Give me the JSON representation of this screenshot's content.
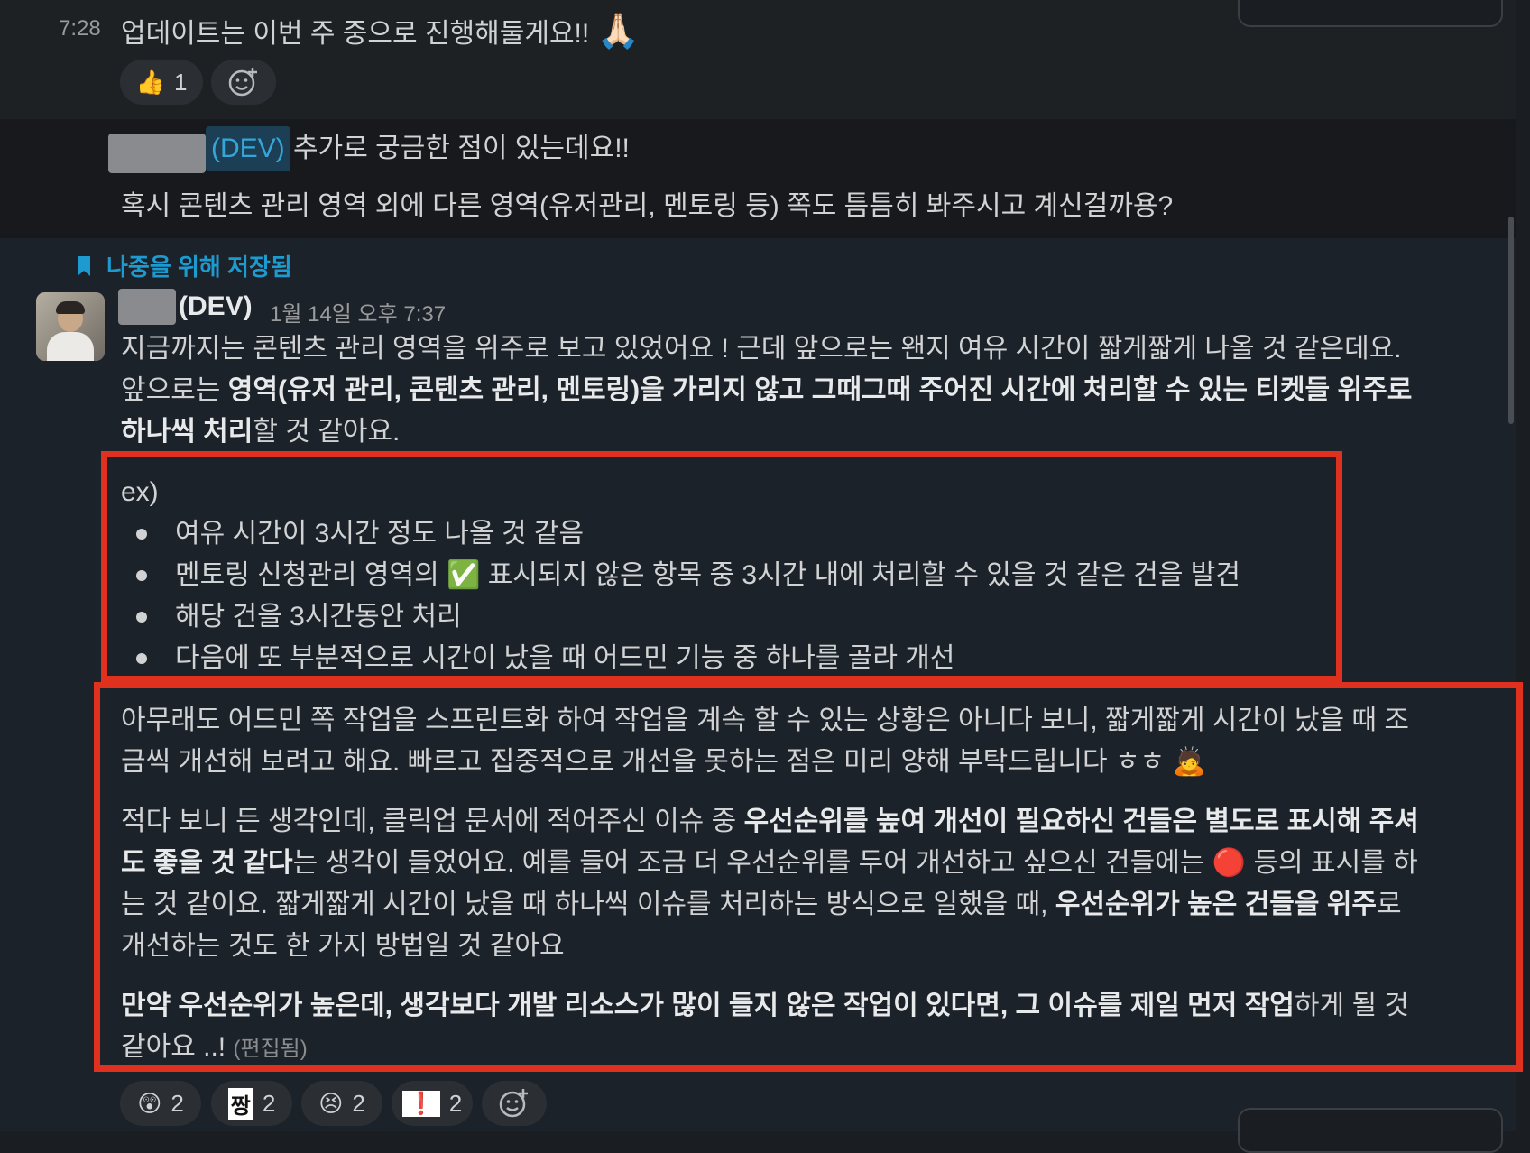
{
  "msg_top": {
    "time": "7:28",
    "text": "업데이트는 이번 주 중으로 진행해둘게요!!",
    "emoji": "🙏🏻",
    "reaction": {
      "emoji": "👍",
      "count": "1"
    }
  },
  "quoted": {
    "author_suffix": "(DEV)",
    "line1": "추가로 궁금한 점이 있는데요!!",
    "line2": "혹시 콘텐츠 관리 영역 외에 다른 영역(유저관리, 멘토링 등) 쪽도 틈틈히 봐주시고 계신걸까용?"
  },
  "saved_label": "나중을 위해 저장됨",
  "message": {
    "author_suffix": "(DEV)",
    "timestamp": "1월 14일 오후 7:37",
    "p1_line1": "지금까지는 콘텐츠 관리 영역을 위주로 보고 있었어요 ! 근데 앞으로는 왠지 여유 시간이 짧게짧게 나올 것 같은데요.",
    "p1_line2_pre": "앞으로는 ",
    "p1_line2_bold": "영역(유저 관리, 콘텐츠 관리, 멘토링)을 가리지 않고 그때그때 주어진 시간에 처리할 수 있는 티켓들 위주로",
    "p1_line3_bold": "하나씩 처리",
    "p1_line3_post": "할 것 같아요.",
    "ex_label": "ex)",
    "bullets": [
      "여유 시간이 3시간 정도 나올 것 같음",
      "멘토링 신청관리 영역의 ✅ 표시되지 않은 항목 중 3시간 내에 처리할 수 있을 것 같은 건을 발견",
      "해당 건을 3시간동안 처리",
      "다음에 또 부분적으로 시간이 났을 때 어드민 기능 중 하나를 골라 개선"
    ],
    "p2_line1": "아무래도 어드민 쪽 작업을 스프린트화 하여 작업을 계속 할 수 있는 상황은 아니다 보니, 짧게짧게 시간이 났을 때 조",
    "p2_line2": "금씩 개선해 보려고 해요. 빠르고 집중적으로 개선을 못하는 점은 미리 양해 부탁드립니다 ㅎㅎ",
    "p2_emoji": "🙇",
    "p3_line1_pre": "적다 보니 든 생각인데, 클릭업 문서에 적어주신 이슈 중 ",
    "p3_line1_bold": "우선순위를 높여 개선이 필요하신 건들은 별도로 표시해 주셔",
    "p3_line2_bold": "도 좋을 것 같다",
    "p3_line2_post_a": "는 생각이 들었어요. 예를 들어 조금 더 우선순위를 두어 개선하고 싶으신 건들에는 ",
    "p3_line2_emoji": "🔴",
    "p3_line2_post_b": " 등의 표시를 하",
    "p3_line3_pre": "는 것 같이요. 짧게짧게 시간이 났을 때 하나씩 이슈를 처리하는 방식으로 일했을 때, ",
    "p3_line3_bold": "우선순위가 높은 건들을 위주",
    "p3_line3_post": "로",
    "p3_line4": "개선하는 것도 한 가지 방법일 것 같아요",
    "p4_line1_bold": "만약 우선순위가 높은데, 생각보다 개발 리소스가 많이 들지 않은 작업이 있다면, 그 이슈를 제일 먼저 작업",
    "p4_line1_post": "하게 될 것",
    "p4_line2": "같아요 ..!",
    "edited": "(편집됨)"
  },
  "reactions": [
    {
      "emoji": "😲",
      "count": "2"
    },
    {
      "emoji": "짱",
      "count": "2"
    },
    {
      "emoji": "😣",
      "count": "2"
    },
    {
      "emoji": "❗",
      "count": "2"
    }
  ],
  "colors": {
    "accent_blue": "#1d9bd1",
    "annotation_red": "#e0311f",
    "background": "#1a1d21"
  }
}
